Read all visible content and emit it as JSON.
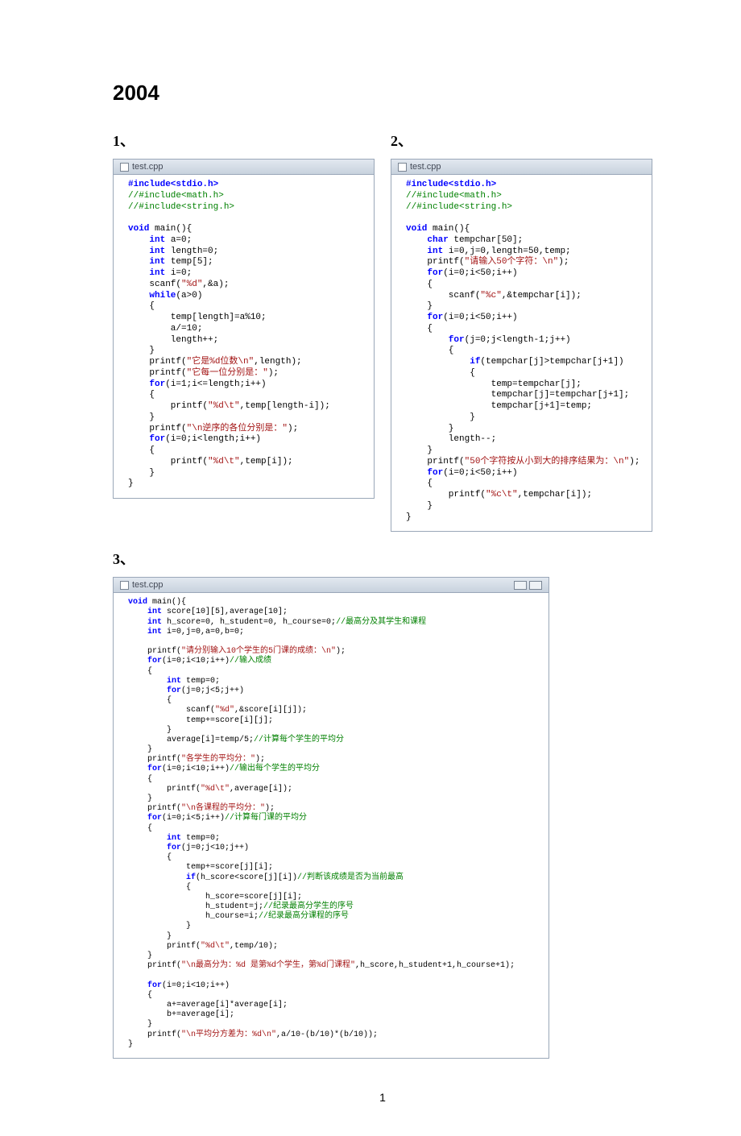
{
  "year_heading": "2004",
  "label_1": "1、",
  "label_2": "2、",
  "label_3": "3、",
  "tab_name": "test.cpp",
  "page_number": "1",
  "code1": {
    "l1a": "#include<stdio.h>",
    "l2a": "//#include<math.h>",
    "l3a": "//#include<string.h>",
    "l5a": "void",
    "l5b": " main(){",
    "l6a": "    int",
    "l6b": " a=0;",
    "l7a": "    int",
    "l7b": " length=0;",
    "l8a": "    int",
    "l8b": " temp[5];",
    "l9a": "    int",
    "l9b": " i=0;",
    "l10a": "    scanf(",
    "l10b": "\"%d\"",
    "l10c": ",&a);",
    "l11a": "    while",
    "l11b": "(a>0)",
    "l12": "    {",
    "l13": "        temp[length]=a%10;",
    "l14": "        a/=10;",
    "l15": "        length++;",
    "l16": "    }",
    "l17a": "    printf(",
    "l17b": "\"它是%d位数\\n\"",
    "l17c": ",length);",
    "l18a": "    printf(",
    "l18b": "\"它每一位分别是：\"",
    "l18c": ");",
    "l19a": "    for",
    "l19b": "(i=1;i<=length;i++)",
    "l20": "    {",
    "l21a": "        printf(",
    "l21b": "\"%d\\t\"",
    "l21c": ",temp[length-i]);",
    "l22": "    }",
    "l23a": "    printf(",
    "l23b": "\"\\n逆序的各位分别是：\"",
    "l23c": ");",
    "l24a": "    for",
    "l24b": "(i=0;i<length;i++)",
    "l25": "    {",
    "l26a": "        printf(",
    "l26b": "\"%d\\t\"",
    "l26c": ",temp[i]);",
    "l27": "    }",
    "l28": "}"
  },
  "code2": {
    "l1a": "#include<stdio.h>",
    "l2a": "//#include<math.h>",
    "l3a": "//#include<string.h>",
    "l5a": "void",
    "l5b": " main(){",
    "l6a": "    char",
    "l6b": " tempchar[50];",
    "l7a": "    int",
    "l7b": " i=0,j=0,length=50,temp;",
    "l8a": "    printf(",
    "l8b": "\"请输入50个字符：\\n\"",
    "l8c": ");",
    "l9a": "    for",
    "l9b": "(i=0;i<50;i++)",
    "l10": "    {",
    "l11a": "        scanf(",
    "l11b": "\"%c\"",
    "l11c": ",&tempchar[i]);",
    "l12": "    }",
    "l13a": "    for",
    "l13b": "(i=0;i<50;i++)",
    "l14": "    {",
    "l15a": "        for",
    "l15b": "(j=0;j<length-1;j++)",
    "l16": "        {",
    "l17a": "            if",
    "l17b": "(tempchar[j]>tempchar[j+1])",
    "l18": "            {",
    "l19": "                temp=tempchar[j];",
    "l20": "                tempchar[j]=tempchar[j+1];",
    "l21": "                tempchar[j+1]=temp;",
    "l22": "            }",
    "l23": "        }",
    "l24": "        length--;",
    "l25": "    }",
    "l26a": "    printf(",
    "l26b": "\"50个字符按从小到大的排序结果为：\\n\"",
    "l26c": ");",
    "l27a": "    for",
    "l27b": "(i=0;i<50;i++)",
    "l28": "    {",
    "l29a": "        printf(",
    "l29b": "\"%c\\t\"",
    "l29c": ",tempchar[i]);",
    "l30": "    }",
    "l31": "}"
  },
  "code3": {
    "l1a": "void",
    "l1b": " main(){",
    "l2a": "    int",
    "l2b": " score[10][5],average[10];",
    "l3a": "    int",
    "l3b": " h_score=0, h_student=0, h_course=0;",
    "l3c": "//最高分及其学生和课程",
    "l4a": "    int",
    "l4b": " i=0,j=0,a=0,b=0;",
    "l6a": "    printf(",
    "l6b": "\"请分别输入10个学生的5门课的成绩：\\n\"",
    "l6c": ");",
    "l7a": "    for",
    "l7b": "(i=0;i<10;i++)",
    "l7c": "//输入成绩",
    "l8": "    {",
    "l9a": "        int",
    "l9b": " temp=0;",
    "l10a": "        for",
    "l10b": "(j=0;j<5;j++)",
    "l11": "        {",
    "l12a": "            scanf(",
    "l12b": "\"%d\"",
    "l12c": ",&score[i][j]);",
    "l13": "            temp+=score[i][j];",
    "l14": "        }",
    "l15a": "        average[i]=temp/5;",
    "l15b": "//计算每个学生的平均分",
    "l16": "    }",
    "l17a": "    printf(",
    "l17b": "\"各学生的平均分：\"",
    "l17c": ");",
    "l18a": "    for",
    "l18b": "(i=0;i<10;i++)",
    "l18c": "//输出每个学生的平均分",
    "l19": "    {",
    "l20a": "        printf(",
    "l20b": "\"%d\\t\"",
    "l20c": ",average[i]);",
    "l21": "    }",
    "l22a": "    printf(",
    "l22b": "\"\\n各课程的平均分：\"",
    "l22c": ");",
    "l23a": "    for",
    "l23b": "(i=0;i<5;i++)",
    "l23c": "//计算每门课的平均分",
    "l24": "    {",
    "l25a": "        int",
    "l25b": " temp=0;",
    "l26a": "        for",
    "l26b": "(j=0;j<10;j++)",
    "l27": "        {",
    "l28": "            temp+=score[j][i];",
    "l29a": "            if",
    "l29b": "(h_score<score[j][i])",
    "l29c": "//判断该成绩是否为当前最高",
    "l30": "            {",
    "l31": "                h_score=score[j][i];",
    "l32a": "                h_student=j;",
    "l32b": "//纪录最高分学生的序号",
    "l33a": "                h_course=i;",
    "l33b": "//纪录最高分课程的序号",
    "l34": "            }",
    "l35": "        }",
    "l36a": "        printf(",
    "l36b": "\"%d\\t\"",
    "l36c": ",temp/10);",
    "l37": "    }",
    "l38a": "    printf(",
    "l38b": "\"\\n最高分为：%d 是第%d个学生，第%d门课程\"",
    "l38c": ",h_score,h_student+1,h_course+1);",
    "l40a": "    for",
    "l40b": "(i=0;i<10;i++)",
    "l41": "    {",
    "l42": "        a+=average[i]*average[i];",
    "l43": "        b+=average[i];",
    "l44": "    }",
    "l45a": "    printf(",
    "l45b": "\"\\n平均分方差为：%d\\n\"",
    "l45c": ",a/10-(b/10)*(b/10));",
    "l46": "}"
  }
}
